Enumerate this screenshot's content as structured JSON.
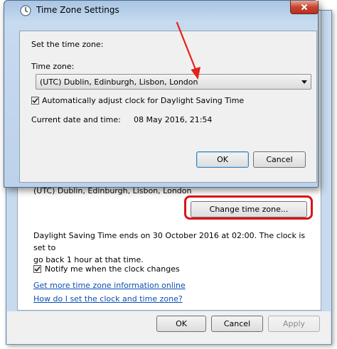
{
  "background_dialog": {
    "timezone_text": "(UTC) Dublin, Edinburgh, Lisbon, London",
    "change_timezone_label": "Change time zone...",
    "dst_text_line1": "Daylight Saving Time ends on 30 October 2016 at 02:00. The clock is set to",
    "dst_text_line2": "go back 1 hour at that time.",
    "notify_label": "Notify me when the clock changes",
    "notify_checked": true,
    "link_more_info": "Get more time zone information online",
    "link_how_set": "How do I set the clock and time zone?",
    "footer": {
      "ok_label": "OK",
      "cancel_label": "Cancel",
      "apply_label": "Apply"
    }
  },
  "timezone_dialog": {
    "title": "Time Zone Settings",
    "set_label": "Set the time zone:",
    "timezone_label": "Time zone:",
    "selected_timezone": "(UTC) Dublin, Edinburgh, Lisbon, London",
    "dst_checkbox_label": "Automatically adjust clock for Daylight Saving Time",
    "dst_checked": true,
    "current_label": "Current date and time:",
    "current_value": "08 May 2016, 21:54",
    "ok_label": "OK",
    "cancel_label": "Cancel"
  },
  "annotations": {
    "arrow_color": "#e8201a",
    "highlight_color": "#d8151a"
  }
}
